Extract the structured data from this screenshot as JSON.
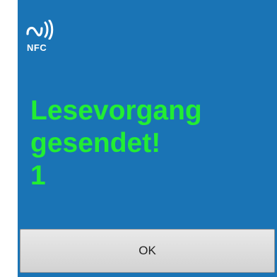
{
  "header": {
    "logo_icon": "nfc-waves-icon",
    "logo_text": "NFC"
  },
  "message": {
    "line1": "Lesevorgang",
    "line2": "gesendet!",
    "line3": "1"
  },
  "buttons": {
    "ok_label": "OK"
  },
  "colors": {
    "dialog_background": "#1a74b5",
    "message_text": "#22ee33",
    "button_background": "#dddddd"
  }
}
